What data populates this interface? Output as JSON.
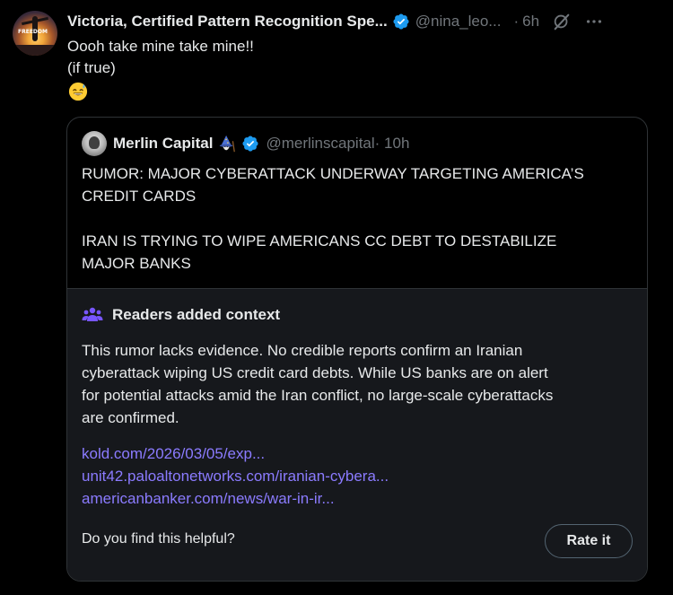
{
  "post": {
    "author_name": "Victoria, Certified Pattern Recognition Spe...",
    "handle": "@nina_leo...",
    "separator": "·",
    "time": "6h",
    "avatar_text": "FREEDOM",
    "text_lines": [
      "Oooh take mine take mine!!",
      "(if true)"
    ],
    "emoji": "sweat-smile-emoji"
  },
  "quote": {
    "name": "Merlin Capital",
    "handle": "@merlinscapital",
    "time": "· 10h",
    "lines": [
      "RUMOR: MAJOR CYBERATTACK UNDERWAY TARGETING AMERICA’S",
      "CREDIT CARDS",
      "",
      "IRAN IS TRYING TO WIPE AMERICANS CC DEBT TO DESTABILIZE",
      "MAJOR BANKS"
    ]
  },
  "notes": {
    "title": "Readers added context",
    "body_lines": [
      "This rumor lacks evidence. No credible reports confirm an Iranian",
      "cyberattack wiping US credit card debts. While US banks are on alert",
      "for potential attacks amid the Iran conflict, no large-scale cyberattacks",
      "are confirmed."
    ],
    "links": [
      "kold.com/2026/03/05/exp...",
      "unit42.paloaltonetworks.com/iranian-cybera...",
      "americanbanker.com/news/war-in-ir..."
    ],
    "helpful_prompt": "Do you find this helpful?",
    "rate_label": "Rate it"
  },
  "colors": {
    "background": "#000000",
    "text": "#e7e9ea",
    "muted": "#71767b",
    "verified": "#1d9bf0",
    "link": "#8b7bff",
    "notes_bg": "#16181c",
    "border": "#2f3336"
  }
}
